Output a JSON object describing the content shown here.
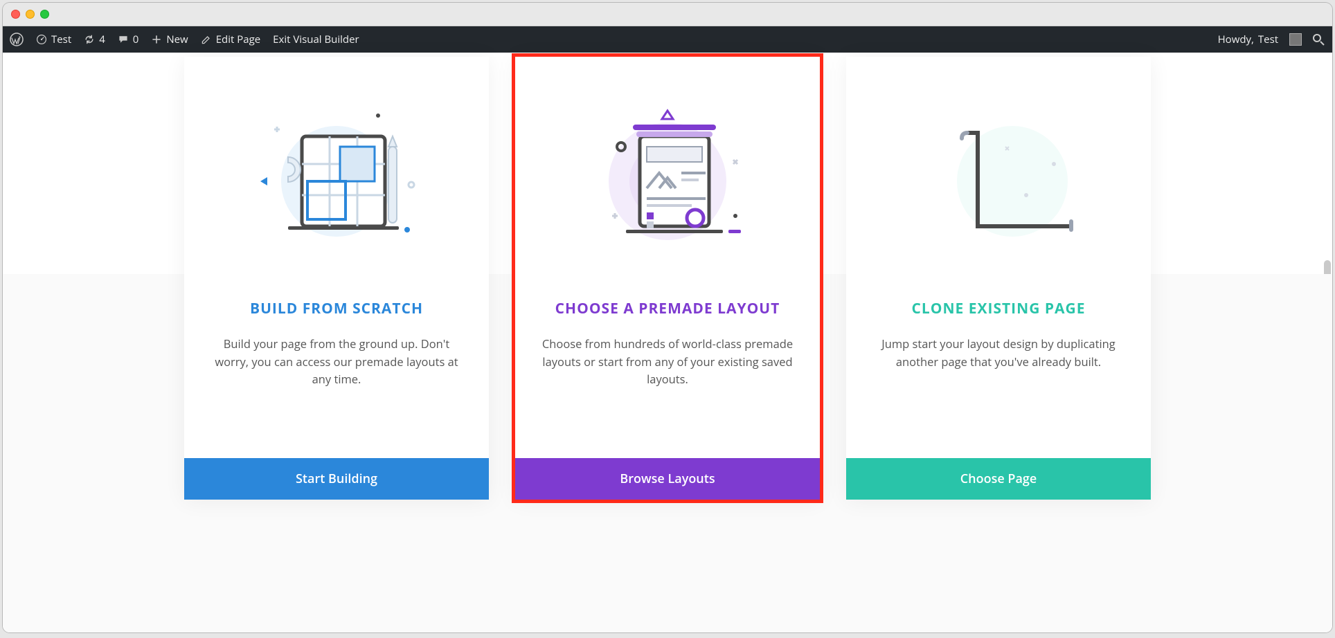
{
  "adminbar": {
    "site_name": "Test",
    "updates_count": "4",
    "comments_count": "0",
    "new_label": "New",
    "edit_page_label": "Edit Page",
    "exit_builder_label": "Exit Visual Builder",
    "howdy_prefix": "Howdy, ",
    "user_name": "Test"
  },
  "cards": [
    {
      "title": "Build From Scratch",
      "description": "Build your page from the ground up. Don't worry, you can access our premade layouts at any time.",
      "button": "Start Building",
      "accent": "#2b87da"
    },
    {
      "title": "Choose A Premade Layout",
      "description": "Choose from hundreds of world-class premade layouts or start from any of your existing saved layouts.",
      "button": "Browse Layouts",
      "accent": "#7e3bd0"
    },
    {
      "title": "Clone Existing Page",
      "description": "Jump start your layout design by duplicating another page that you've already built.",
      "button": "Choose Page",
      "accent": "#29c4a9"
    }
  ],
  "highlighted_card_index": 1
}
